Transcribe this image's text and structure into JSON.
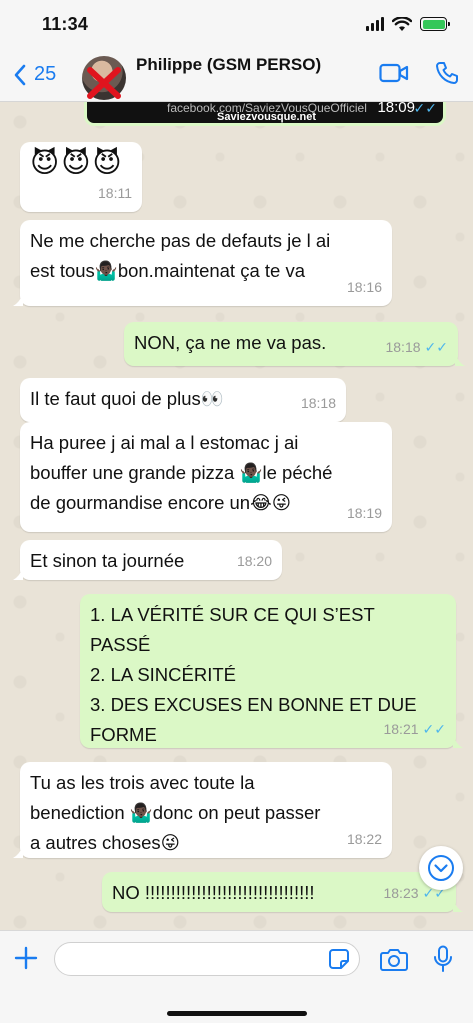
{
  "status_bar": {
    "time": "11:34"
  },
  "header": {
    "back_count": "25",
    "contact_name": "Philippe (GSM PERSO)",
    "accent_color": "#1a7cf0"
  },
  "forwarded_image": {
    "line1": "facebook.com/SaviezVousQueOfficiel",
    "line2": "Saviezvousque.net",
    "time": "18:09"
  },
  "messages": [
    {
      "direction": "in",
      "text": "😈😈😈",
      "time": "18:11"
    },
    {
      "direction": "in",
      "text": "Ne me cherche pas de defauts je l ai\nest tous🤷🏿‍♂️bon.maintenat ça te va",
      "time": "18:16"
    },
    {
      "direction": "out",
      "text": "NON, ça ne me va pas.",
      "time": "18:18"
    },
    {
      "direction": "in",
      "text": "Il te faut quoi de plus👀",
      "time": "18:18"
    },
    {
      "direction": "in",
      "text": "Ha puree j ai mal a l estomac j ai\nbouffer une grande pizza 🤷🏿‍♂️le péché\nde gourmandise encore un😂😜",
      "time": "18:19"
    },
    {
      "direction": "in",
      "text": "Et sinon ta journée",
      "time": "18:20"
    },
    {
      "direction": "out",
      "text": "1. LA VÉRITÉ SUR CE QUI S’EST\nPASSÉ\n2. LA SINCÉRITÉ\n3. DES EXCUSES EN BONNE ET DUE\nFORME",
      "time": "18:21"
    },
    {
      "direction": "in",
      "text": "Tu as les trois avec toute la\nbenediction 🤷🏿‍♂️donc on peut passer\na autres choses😜",
      "time": "18:22"
    },
    {
      "direction": "out",
      "text": "NO !!!!!!!!!!!!!!!!!!!!!!!!!!!!!!!!!",
      "time": "18:23"
    }
  ],
  "input_bar": {
    "placeholder": ""
  },
  "colors": {
    "incoming_bubble": "#ffffff",
    "outgoing_bubble": "#dbf8c6",
    "read_ticks": "#4fb6ec",
    "chat_background": "#e9e3d7"
  },
  "icons": [
    "back-chevron-icon",
    "video-call-icon",
    "phone-icon",
    "chevron-down-icon",
    "plus-icon",
    "sticker-icon",
    "camera-icon",
    "microphone-icon"
  ]
}
